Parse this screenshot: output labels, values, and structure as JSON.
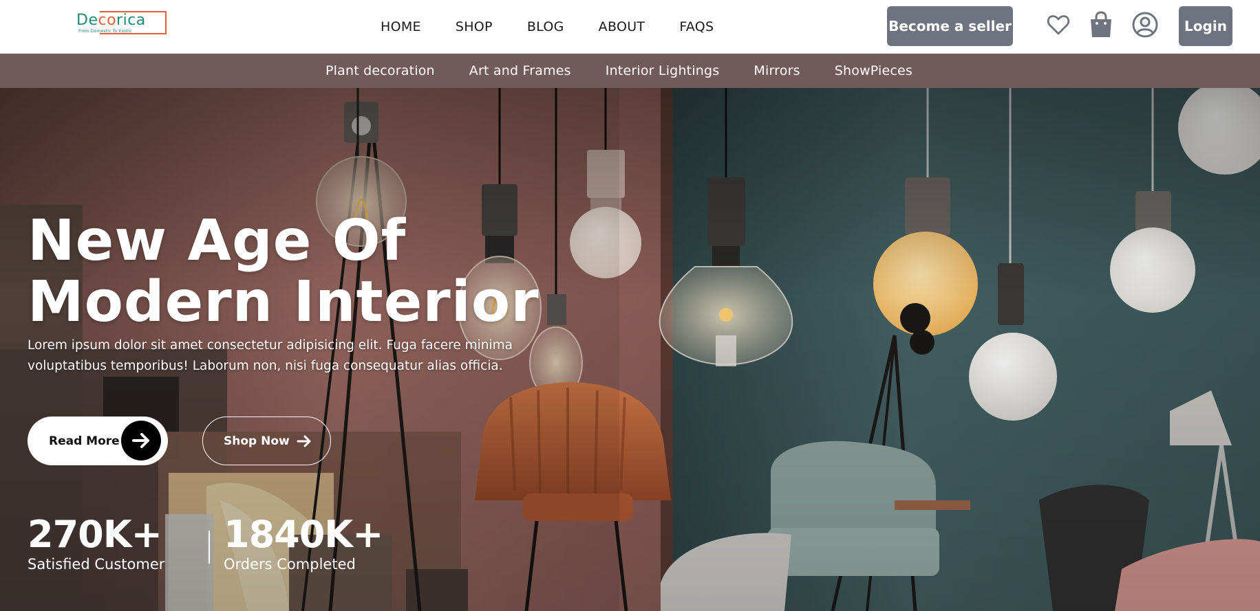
{
  "logo": {
    "text_part1": "De",
    "text_part2": "co",
    "text_part3": "rica",
    "tagline": "From Domestic To Exotic"
  },
  "nav": {
    "items": [
      "HOME",
      "SHOP",
      "BLOG",
      "ABOUT",
      "FAQS"
    ]
  },
  "header": {
    "seller_label": "Become a seller",
    "login_label": "Login",
    "icons": [
      "heart-icon",
      "shopping-bag-icon",
      "user-account-icon"
    ]
  },
  "categories": {
    "items": [
      "Plant decoration",
      "Art and Frames",
      "Interior Lightings",
      "Mirrors",
      "ShowPieces"
    ]
  },
  "hero": {
    "title_line1": "New Age Of",
    "title_line2": "Modern Interior",
    "description": "Lorem ipsum dolor sit amet consectetur adipisicing elit. Fuga facere minima voluptatibus temporibus! Laborum non, nisi fuga consequatur alias officia.",
    "read_more_label": "Read More",
    "shop_now_label": "Shop Now"
  },
  "stats": [
    {
      "value": "270K+",
      "caption": "Satisfied Customer"
    },
    {
      "value": "1840K+",
      "caption": "Orders Completed"
    }
  ],
  "colors": {
    "header_button": "#6f7380",
    "category_bar": "#725a5a",
    "logo_green": "#1f8a77",
    "logo_orange": "#e0603a",
    "wall_left": "#9b6a63",
    "wall_right": "#3e5859",
    "chair_orange": "#c86a3e"
  }
}
